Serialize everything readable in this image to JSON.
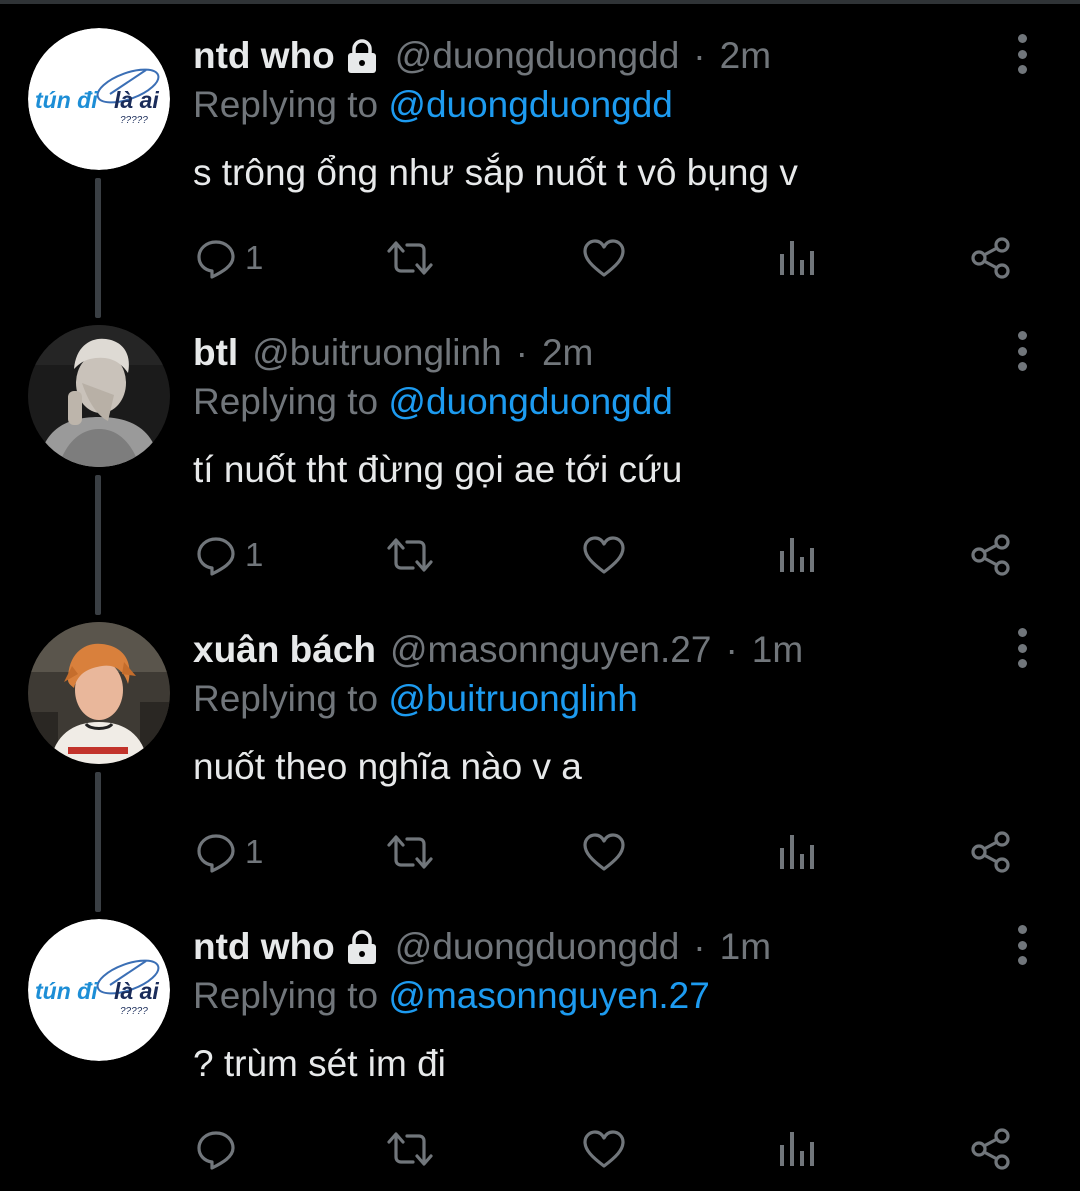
{
  "colors": {
    "background": "#000000",
    "text_primary": "#e7e9ea",
    "text_secondary": "#71767b",
    "link": "#1d9bf0",
    "thread_line": "#3a3f44"
  },
  "avatars": {
    "ntd_logo": {
      "text_main": "tún đi",
      "text_accent": "là ai",
      "text_small": "?????"
    }
  },
  "tweets": [
    {
      "name": "ntd who",
      "locked": true,
      "handle": "@duongduongdd",
      "separator": "·",
      "time": "2m",
      "replying_prefix": "Replying to",
      "replying_to": "@duongduongdd",
      "text": "s trông ổng như sắp nuốt t vô bụng v",
      "reply_count": "1",
      "avatar": "ntd-logo"
    },
    {
      "name": "btl",
      "locked": false,
      "handle": "@buitruonglinh",
      "separator": "·",
      "time": "2m",
      "replying_prefix": "Replying to",
      "replying_to": "@duongduongdd",
      "text": "tí nuốt tht đừng gọi ae tới cứu",
      "reply_count": "1",
      "avatar": "photo-gray"
    },
    {
      "name": "xuân bách",
      "locked": false,
      "handle": "@masonnguyen.27",
      "separator": "·",
      "time": "1m",
      "replying_prefix": "Replying to",
      "replying_to": "@buitruonglinh",
      "text": "nuốt theo nghĩa nào v a",
      "reply_count": "1",
      "avatar": "photo-orange"
    },
    {
      "name": "ntd who",
      "locked": true,
      "handle": "@duongduongdd",
      "separator": "·",
      "time": "1m",
      "replying_prefix": "Replying to",
      "replying_to": "@masonnguyen.27",
      "text": "? trùm sét im đi",
      "reply_count": "",
      "avatar": "ntd-logo"
    }
  ],
  "icons": {
    "reply": "comment-bubble-icon",
    "retweet": "retweet-icon",
    "like": "heart-icon",
    "views": "views-bar-chart-icon",
    "share": "share-icon",
    "lock": "lock-icon",
    "more": "more-vertical-icon"
  }
}
